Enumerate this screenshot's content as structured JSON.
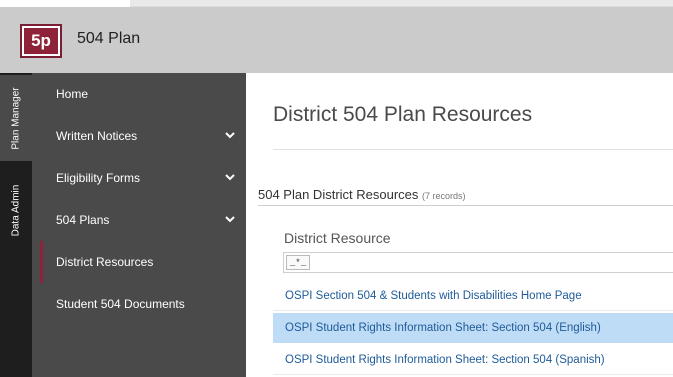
{
  "header": {
    "logo_text": "5p",
    "app_title": "504 Plan",
    "brand_color": "#8e2239"
  },
  "vertical_tabs": [
    {
      "label": "Plan Manager",
      "active": true
    },
    {
      "label": "Data Admin",
      "active": false
    }
  ],
  "sidebar": {
    "items": [
      {
        "label": "Home",
        "has_chevron": false,
        "active": false
      },
      {
        "label": "Written Notices",
        "has_chevron": true,
        "icon": "chevron-down-icon",
        "active": false
      },
      {
        "label": "Eligibility Forms",
        "has_chevron": true,
        "icon": "chevron-down-icon",
        "active": false
      },
      {
        "label": "504 Plans",
        "has_chevron": true,
        "icon": "chevron-down-icon",
        "active": false
      },
      {
        "label": "District Resources",
        "has_chevron": false,
        "active": true
      },
      {
        "label": "Student 504 Documents",
        "has_chevron": false,
        "active": false
      }
    ]
  },
  "main": {
    "page_title": "District 504 Plan Resources",
    "section_title": "504 Plan District Resources",
    "record_count": "(7 records)",
    "column_header": "District Resource",
    "filter_button": "_*_",
    "rows": [
      {
        "label": "OSPI Section 504 & Students with Disabilities Home Page",
        "selected": false
      },
      {
        "label": "OSPI Student Rights Information Sheet: Section 504 (English)",
        "selected": true
      },
      {
        "label": "OSPI Student Rights Information Sheet: Section 504 (Spanish)",
        "selected": false
      }
    ],
    "link_color": "#1f5b99",
    "selected_row_color": "#bfdcf6"
  }
}
